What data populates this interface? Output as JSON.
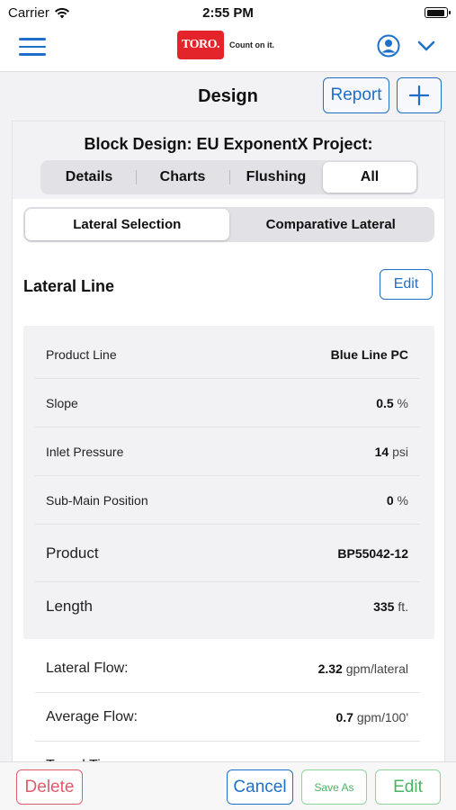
{
  "status_bar": {
    "carrier": "Carrier",
    "time": "2:55 PM"
  },
  "navbar": {
    "logo_brand": "TORO.",
    "logo_tagline": "Count on it."
  },
  "titlebar": {
    "title": "Design",
    "report_label": "Report",
    "add_label": "+"
  },
  "block": {
    "title": "Block Design: EU ExponentX Project:",
    "tabs": [
      "Details",
      "Charts",
      "Flushing",
      "All"
    ],
    "active_tab": "All",
    "subtabs": [
      "Lateral Selection",
      "Comparative Lateral"
    ],
    "active_subtab": "Lateral Selection"
  },
  "lateral_line": {
    "title": "Lateral Line",
    "edit_label": "Edit",
    "properties": [
      {
        "label": "Product Line",
        "value": "Blue Line PC",
        "unit": ""
      },
      {
        "label": "Slope",
        "value": "0.5",
        "unit": "%"
      },
      {
        "label": "Inlet Pressure",
        "value": "14",
        "unit": "psi"
      },
      {
        "label": "Sub-Main Position",
        "value": "0",
        "unit": "%"
      },
      {
        "label": "Product",
        "value": "BP55042-12",
        "unit": ""
      },
      {
        "label": "Length",
        "value": "335",
        "unit": "ft."
      }
    ],
    "results": [
      {
        "label": "Lateral Flow:",
        "value": "2.32",
        "unit": "gpm/lateral"
      },
      {
        "label": "Average Flow:",
        "value": "0.7",
        "unit": "gpm/100'"
      },
      {
        "label": "Travel Time:",
        "value": "",
        "unit": ""
      }
    ]
  },
  "toolbar": {
    "delete": "Delete",
    "cancel": "Cancel",
    "save_as": "Save As",
    "edit": "Edit"
  },
  "colors": {
    "accent": "#1e6fc9",
    "danger": "#e05a6a",
    "success": "#49b461",
    "brand_red": "#e3242b"
  }
}
